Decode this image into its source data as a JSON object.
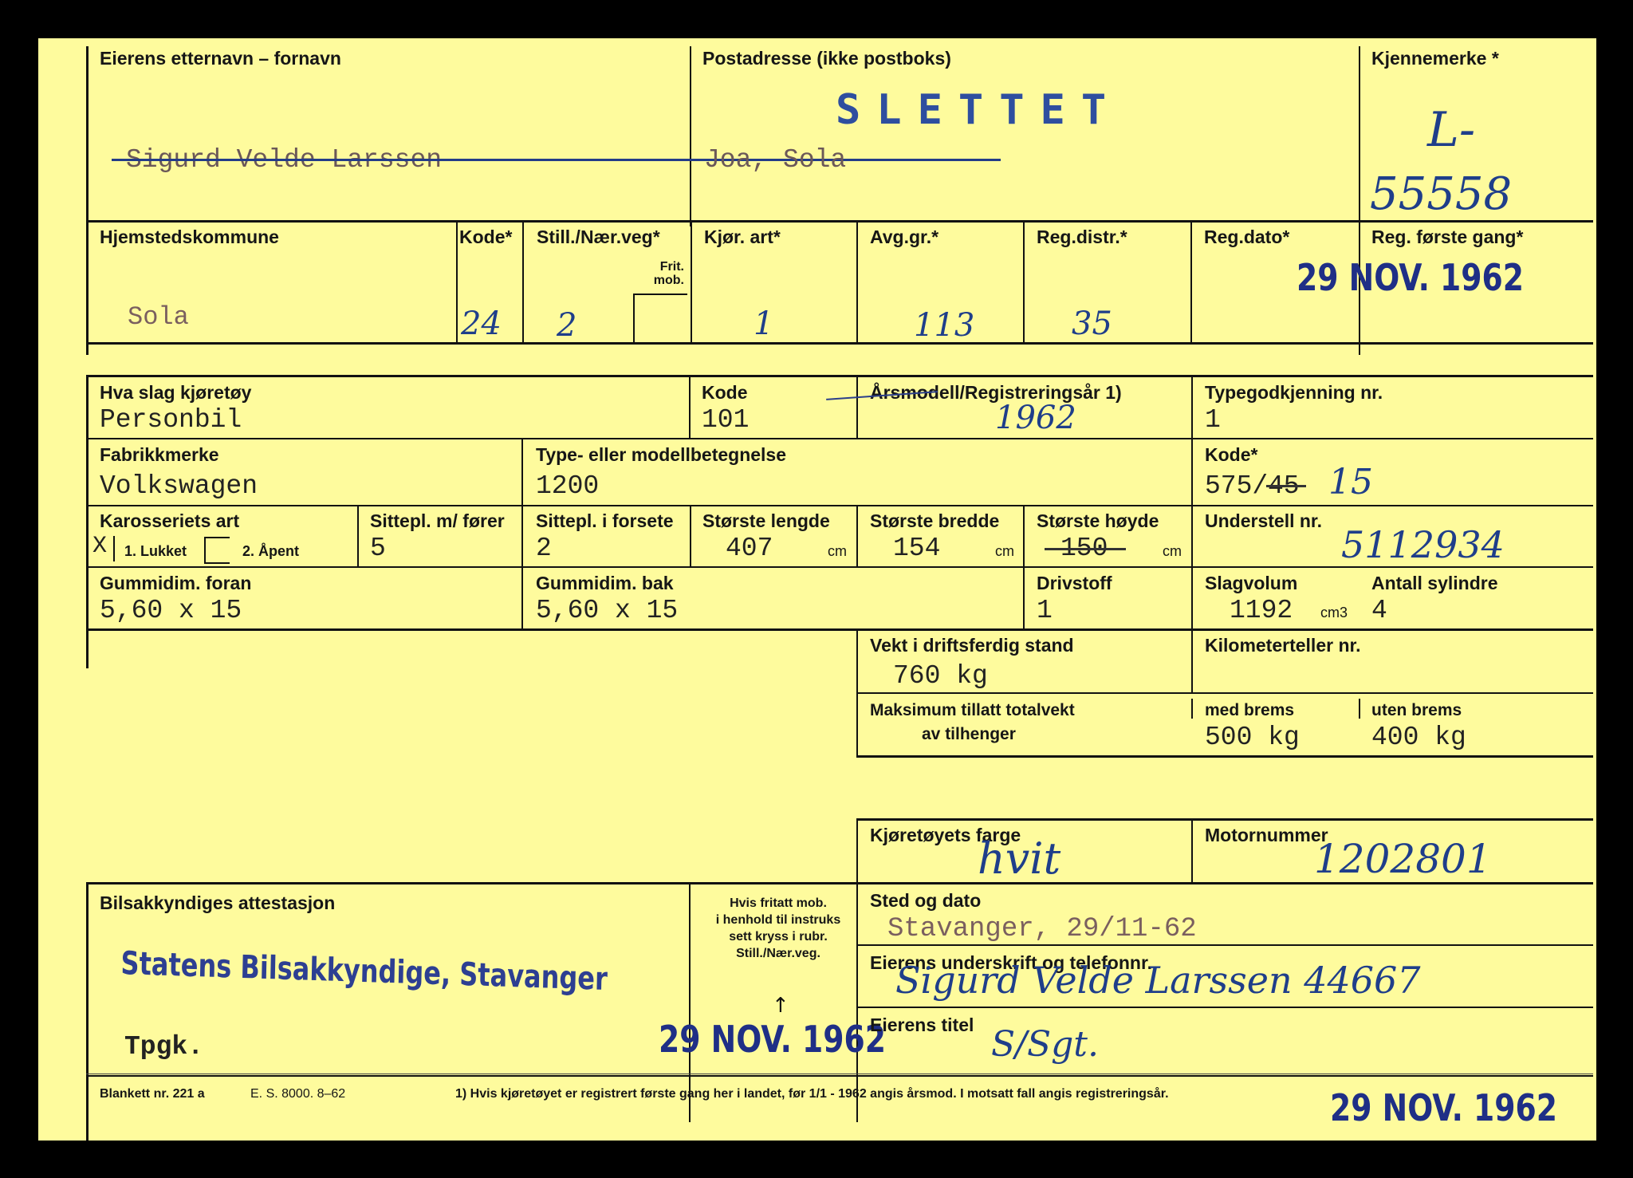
{
  "owner": {
    "name_label": "Eierens etternavn – fornavn",
    "name_value": "Sigurd Velde Larssen",
    "address_label": "Postadresse (ikke postboks)",
    "address_value": "Joa, Sola",
    "slettet_stamp": "SLETTET",
    "plate_label": "Kjennemerke *",
    "plate_prefix": "L-",
    "plate_number": "55558"
  },
  "row2": {
    "hjemsted_label": "Hjemstedskommune",
    "hjemsted_value": "Sola",
    "kode_label": "Kode*",
    "kode_value": "24",
    "still_label": "Still./Nær.veg*",
    "frit_label": "Frit. mob.",
    "still_value": "2",
    "kjor_label": "Kjør. art*",
    "kjor_value": "1",
    "avg_label": "Avg.gr.*",
    "avg_value": "113",
    "regdistr_label": "Reg.distr.*",
    "regdistr_value": "35",
    "regdato_label": "Reg.dato*",
    "forste_label": "Reg. første gang*",
    "date_stamp": "29 NOV. 1962"
  },
  "vehicle": {
    "slag_label": "Hva slag kjøretøy",
    "slag_value": "Personbil",
    "kode_label": "Kode",
    "kode_value": "101",
    "arsmodell_label": "Årsmodell/Registreringsår 1)",
    "arsmodell_value": "1962",
    "typegodkj_label": "Typegodkjenning nr.",
    "typegodkj_value": "1",
    "fabrikk_label": "Fabrikkmerke",
    "fabrikk_value": "Volkswagen",
    "type_label": "Type- eller modellbetegnelse",
    "type_value": "1200",
    "kode2_label": "Kode*",
    "kode2_value": "575/",
    "kode2_struck": "45",
    "kode2_hand": "15",
    "karosseri_label": "Karosseriets art",
    "opt1_mark": "X",
    "opt1_label": "1. Lukket",
    "opt2_label": "2. Åpent",
    "sittepl_forer_label": "Sittepl. m/ fører",
    "sittepl_forer_value": "5",
    "sittepl_forsete_label": "Sittepl. i forsete",
    "sittepl_forsete_value": "2",
    "lengde_label": "Største lengde",
    "lengde_value": "407",
    "bredde_label": "Største bredde",
    "bredde_value": "154",
    "hoyde_label": "Største høyde",
    "hoyde_value": "150",
    "cm_unit": "cm",
    "understell_label": "Understell nr.",
    "understell_value": "5112934",
    "gummi_foran_label": "Gummidim. foran",
    "gummi_foran_value": "5,60 x 15",
    "gummi_bak_label": "Gummidim. bak",
    "gummi_bak_value": "5,60 x 15",
    "drivstoff_label": "Drivstoff",
    "drivstoff_value": "1",
    "slagvolum_label": "Slagvolum",
    "slagvolum_value": "1192",
    "slagvolum_unit": "cm3",
    "sylindre_label": "Antall sylindre",
    "sylindre_value": "4"
  },
  "weight": {
    "vekt_label": "Vekt i driftsferdig stand",
    "vekt_value": "760 kg",
    "km_label": "Kilometerteller nr.",
    "maks_label_1": "Maksimum tillatt totalvekt",
    "maks_label_2": "av tilhenger",
    "med_label": "med brems",
    "med_value": "500 kg",
    "uten_label": "uten brems",
    "uten_value": "400 kg"
  },
  "colour": {
    "farge_label": "Kjøretøyets farge",
    "farge_value": "hvit",
    "motor_label": "Motornummer",
    "motor_value": "1202801"
  },
  "attest": {
    "label": "Bilsakkyndiges attestasjon",
    "stamp": "Statens Bilsakkyndige, Stavanger",
    "tpgk": "Tpgk.",
    "note": [
      "Hvis fritatt mob.",
      "i henhold til instruks",
      "sett kryss i rubr.",
      "Still./Nær.veg."
    ],
    "date_stamp": "29 NOV. 1962",
    "sted_label": "Sted og dato",
    "sted_value": "Stavanger, 29/11-62",
    "underskrift_label": "Eierens underskrift og telefonnr.",
    "underskrift_value": "Sigurd Velde Larssen 44667",
    "tittel_label": "Eierens titel",
    "tittel_value": "S/Sgt."
  },
  "footer": {
    "blankett": "Blankett nr. 221 a",
    "es": "E. S. 8000. 8–62",
    "note": "1)  Hvis kjøretøyet er registrert første gang her i landet, før 1/1 - 1962 angis årsmod.  I motsatt fall angis registreringsår.",
    "date_stamp": "29 NOV. 1962"
  }
}
